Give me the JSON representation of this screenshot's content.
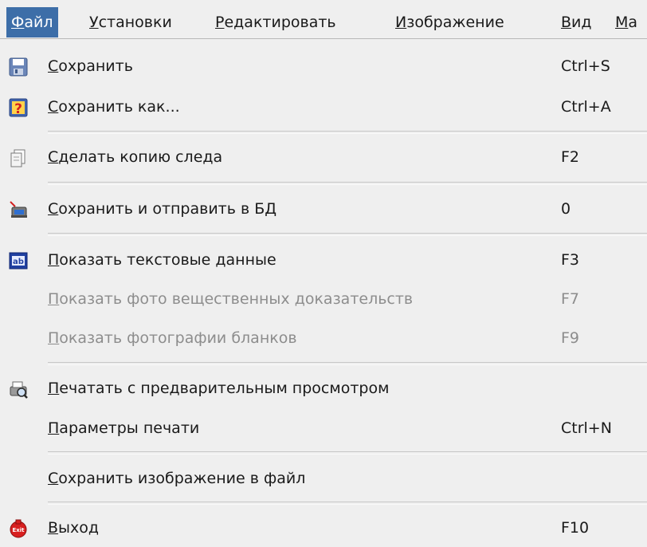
{
  "menubar": {
    "items": [
      {
        "mn": "Ф",
        "rest": "айл",
        "active": true
      },
      {
        "mn": "У",
        "rest": "становки"
      },
      {
        "mn": "Р",
        "rest": "едактировать"
      },
      {
        "mn": "И",
        "rest": "зображение"
      },
      {
        "mn": "В",
        "rest": "ид"
      },
      {
        "mn": "М",
        "rest": "а"
      }
    ]
  },
  "menu": {
    "items": [
      {
        "mn": "С",
        "rest": "охранить",
        "shortcut": "Ctrl+S",
        "icon": "floppy-disk-icon"
      },
      {
        "mn": "С",
        "rest": "охранить как...",
        "shortcut": "Ctrl+A",
        "icon": "save-as-icon"
      },
      {
        "mn": "С",
        "rest": "делать копию следа",
        "shortcut": "F2",
        "icon": "copy-document-icon"
      },
      {
        "mn": "С",
        "rest": "охранить и отправить в БД",
        "shortcut": "0",
        "icon": "send-to-database-icon"
      },
      {
        "mn": "П",
        "rest": "оказать текстовые данные",
        "shortcut": "F3",
        "icon": "text-data-icon"
      },
      {
        "mn": "П",
        "rest": "оказать фото вещественных доказательств",
        "shortcut": "F7",
        "disabled": true
      },
      {
        "mn": "П",
        "rest": "оказать фотографии бланков",
        "shortcut": "F9",
        "disabled": true
      },
      {
        "mn": "П",
        "rest": "ечатать с предварительным просмотром",
        "shortcut": "",
        "icon": "print-preview-icon"
      },
      {
        "mn": "П",
        "rest": "араметры печати",
        "shortcut": "Ctrl+N"
      },
      {
        "mn": "С",
        "rest": "охранить изображение в файл",
        "shortcut": ""
      },
      {
        "mn": "В",
        "rest": "ыход",
        "shortcut": "F10",
        "icon": "exit-icon"
      }
    ]
  },
  "colors": {
    "menu_bg": "#efefef",
    "highlight": "#3d6ea8",
    "disabled_text": "#8d8d8d"
  }
}
